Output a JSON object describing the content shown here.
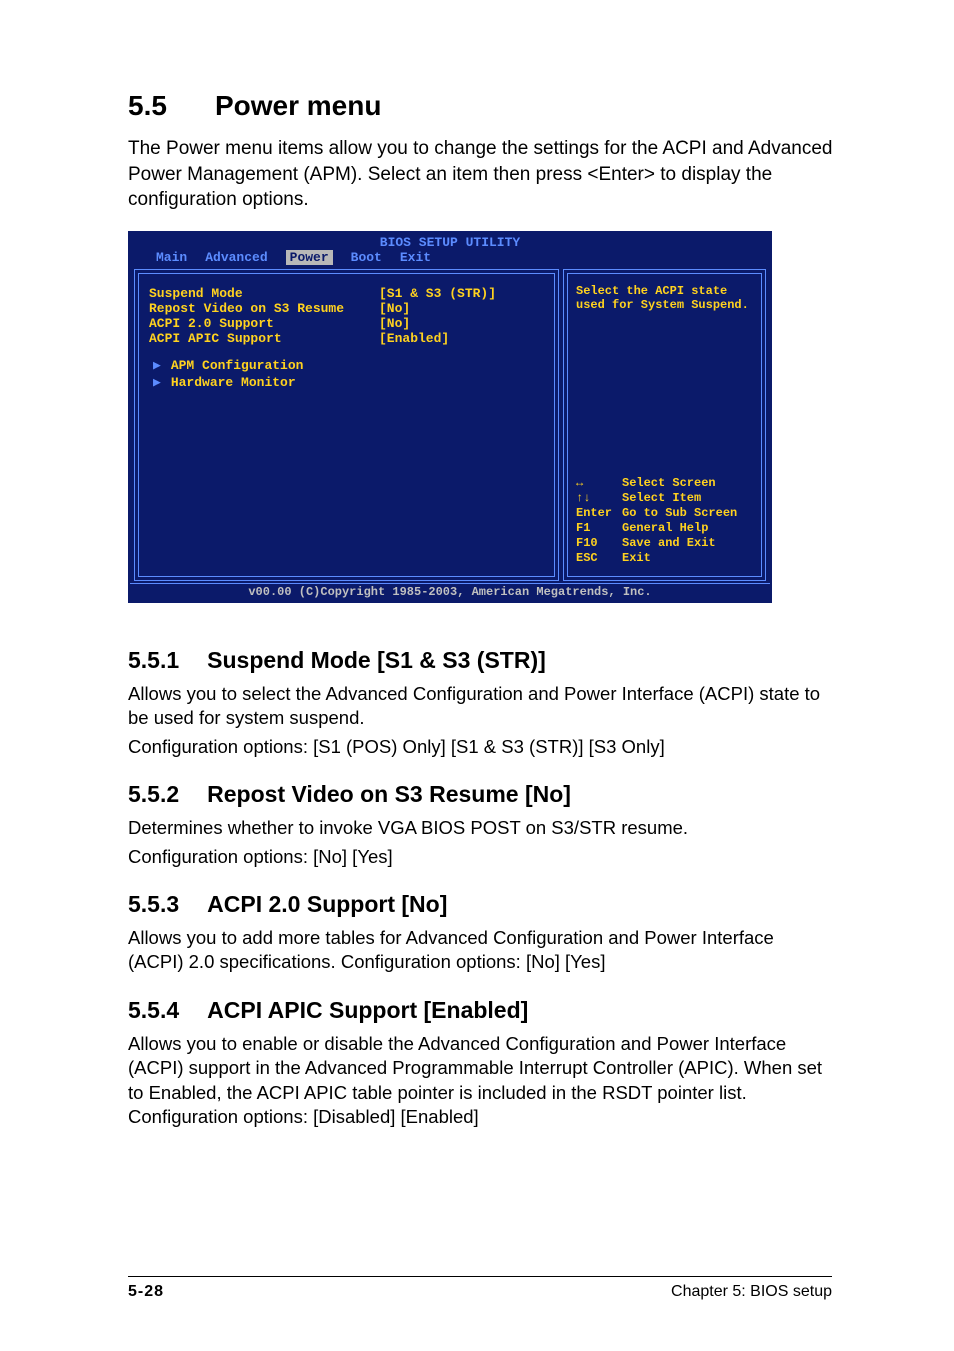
{
  "section": {
    "number": "5.5",
    "title": "Power menu",
    "intro": "The Power menu items allow you to change the settings for the ACPI and Advanced Power Management (APM). Select an item then press <Enter> to display the configuration options."
  },
  "bios": {
    "title": "BIOS SETUP UTILITY",
    "tabs": [
      "Main",
      "Advanced",
      "Power",
      "Boot",
      "Exit"
    ],
    "active_tab": "Power",
    "items": [
      {
        "label": "Suspend Mode",
        "value": "[S1 & S3 (STR)]"
      },
      {
        "label": "Repost Video on S3 Resume",
        "value": "[No]"
      },
      {
        "label": "ACPI 2.0 Support",
        "value": "[No]"
      },
      {
        "label": "ACPI APIC Support",
        "value": "[Enabled]"
      }
    ],
    "submenus": [
      "APM Configuration",
      "Hardware Monitor"
    ],
    "help_text": "Select the ACPI state used for System Suspend.",
    "keys": [
      {
        "key": "↔",
        "action": "Select Screen"
      },
      {
        "key": "↑↓",
        "action": "Select Item"
      },
      {
        "key": "Enter",
        "action": "Go to Sub Screen"
      },
      {
        "key": "F1",
        "action": "General Help"
      },
      {
        "key": "F10",
        "action": "Save and Exit"
      },
      {
        "key": "ESC",
        "action": "Exit"
      }
    ],
    "footer": "v00.00 (C)Copyright 1985-2003, American Megatrends, Inc."
  },
  "subsections": [
    {
      "number": "5.5.1",
      "title": "Suspend Mode [S1 & S3 (STR)]",
      "body1": "Allows you to select the Advanced Configuration and Power Interface (ACPI) state to be used for system suspend.",
      "body2": "Configuration options: [S1 (POS) Only] [S1 & S3 (STR)] [S3 Only]"
    },
    {
      "number": "5.5.2",
      "title": "Repost Video on S3 Resume [No]",
      "body1": "Determines whether to invoke VGA BIOS POST on S3/STR resume.",
      "body2": "Configuration options: [No] [Yes]"
    },
    {
      "number": "5.5.3",
      "title": "ACPI 2.0 Support [No]",
      "body1": "Allows you to add more tables for Advanced Configuration and Power Interface (ACPI) 2.0 specifications. Configuration options: [No] [Yes]",
      "body2": ""
    },
    {
      "number": "5.5.4",
      "title": "ACPI APIC Support [Enabled]",
      "body1": "Allows you to enable or disable the Advanced Configuration and Power Interface (ACPI) support in the Advanced Programmable Interrupt Controller (APIC). When set to Enabled, the ACPI APIC table pointer is included in the RSDT pointer list. Configuration options: [Disabled] [Enabled]",
      "body2": ""
    }
  ],
  "footer": {
    "page": "5-28",
    "chapter": "Chapter 5: BIOS setup"
  }
}
